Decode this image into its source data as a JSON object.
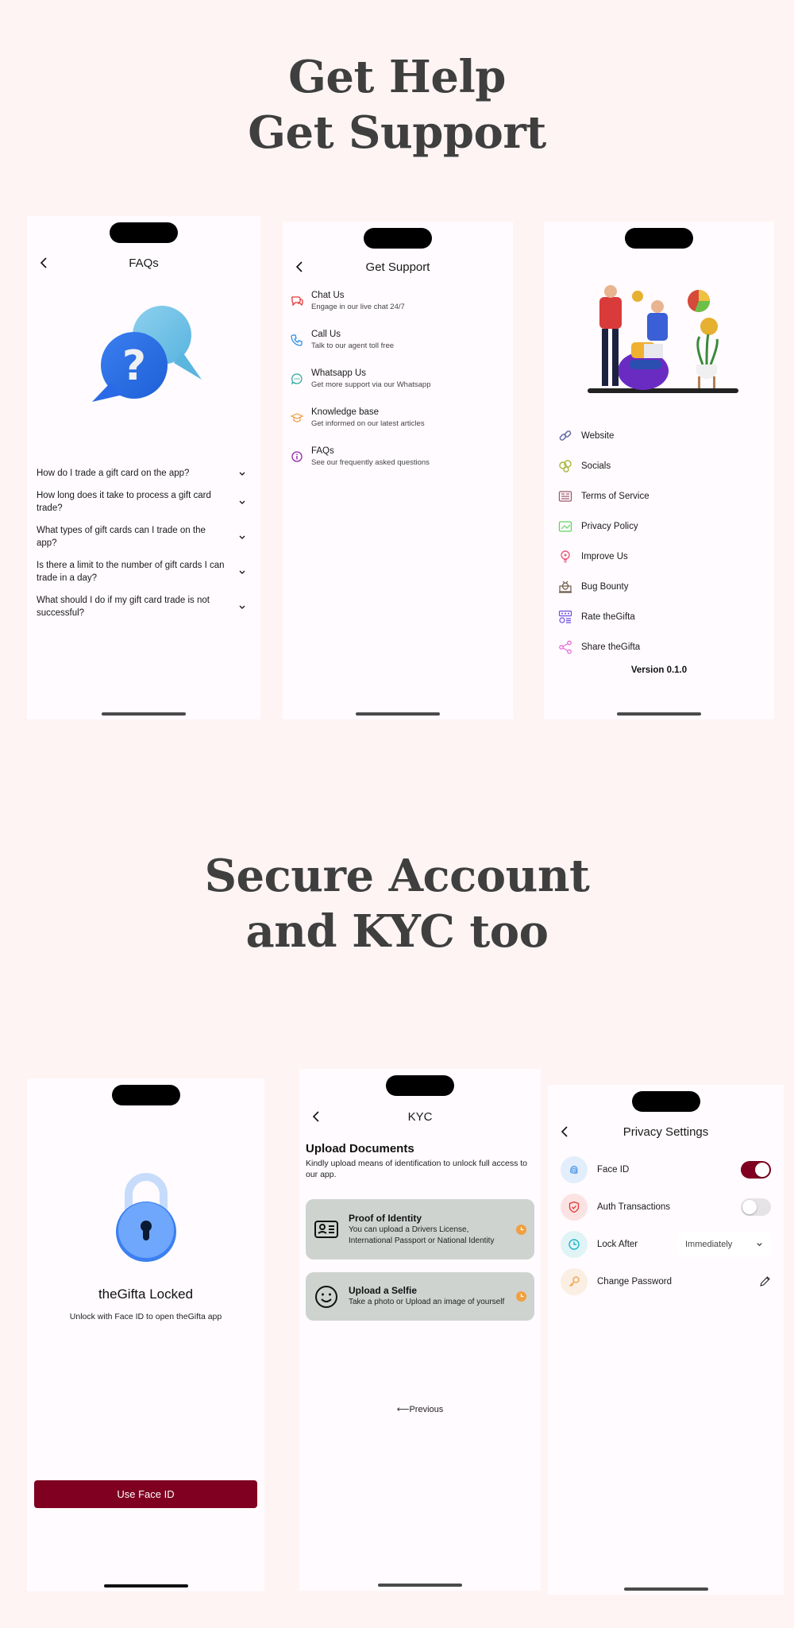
{
  "headlines": {
    "section1": [
      "Get Help",
      "Get Support"
    ],
    "section2": [
      "Secure Account",
      "and KYC too"
    ]
  },
  "faq_screen": {
    "title": "FAQs",
    "items": [
      {
        "question": "How do I trade a gift card on the app?"
      },
      {
        "question": "How long does it take to process a gift card trade?"
      },
      {
        "question": "What types of gift cards can I trade on the app?"
      },
      {
        "question": "Is there a limit to the number of gift cards I can trade in a day?"
      },
      {
        "question": "What should I do if my gift card trade is not successful?"
      }
    ]
  },
  "support_screen": {
    "title": "Get Support",
    "items": [
      {
        "title": "Chat Us",
        "subtitle": "Engage in our live chat 24/7",
        "icon": "chat-bubbles-icon",
        "color": "#e53935"
      },
      {
        "title": "Call Us",
        "subtitle": "Talk to our agent toll free",
        "icon": "phone-icon",
        "color": "#1e88e5"
      },
      {
        "title": "Whatsapp Us",
        "subtitle": "Get more support via our Whatsapp",
        "icon": "message-dots-icon",
        "color": "#26a69a"
      },
      {
        "title": "Knowledge base",
        "subtitle": "Get informed on our latest articles",
        "icon": "graduation-cap-icon",
        "color": "#f09a3e"
      },
      {
        "title": "FAQs",
        "subtitle": "See our frequently asked questions",
        "icon": "info-icon",
        "color": "#8e24aa"
      }
    ]
  },
  "about_screen": {
    "items": [
      {
        "label": "Website",
        "icon": "link-icon",
        "color": "#6b6fa8"
      },
      {
        "label": "Socials",
        "icon": "socials-icon",
        "color": "#a6b83a"
      },
      {
        "label": "Terms of Service",
        "icon": "document-icon",
        "color": "#9b5a6a"
      },
      {
        "label": "Privacy Policy",
        "icon": "privacy-icon",
        "color": "#5fd65f"
      },
      {
        "label": "Improve Us",
        "icon": "lightbulb-icon",
        "color": "#ef5b7a"
      },
      {
        "label": "Bug Bounty",
        "icon": "bug-icon",
        "color": "#6b5a4a"
      },
      {
        "label": "Rate theGifta",
        "icon": "rating-icon",
        "color": "#6a4de0"
      },
      {
        "label": "Share theGifta",
        "icon": "share-icon",
        "color": "#e66fd8"
      }
    ],
    "version": "Version 0.1.0"
  },
  "lock_screen": {
    "title": "theGifta Locked",
    "subtitle": "Unlock with Face ID to open theGifta app",
    "button_label": "Use Face ID"
  },
  "kyc_screen": {
    "title": "KYC",
    "heading": "Upload Documents",
    "description": "Kindly upload means of identification to unlock full access to our app.",
    "cards": [
      {
        "title": "Proof of Identity",
        "subtitle": "You can upload a Drivers License, International Passport or National Identity",
        "status": "pending"
      },
      {
        "title": "Upload a Selfie",
        "subtitle": "Take a photo or Upload an image of yourself",
        "status": "pending"
      }
    ],
    "previous_label": "⟵Previous"
  },
  "privacy_screen": {
    "title": "Privacy Settings",
    "face_id": {
      "label": "Face ID",
      "enabled": true
    },
    "auth_transactions": {
      "label": "Auth Transactions",
      "enabled": false
    },
    "lock_after": {
      "label": "Lock After",
      "value": "Immediately"
    },
    "change_password": {
      "label": "Change Password"
    }
  },
  "colors": {
    "page_bg": "#fef4f4",
    "accent": "#7f0020",
    "headline": "#3f3f3f",
    "pending": "#f0a040",
    "kyc_card": "#ced3d0"
  }
}
